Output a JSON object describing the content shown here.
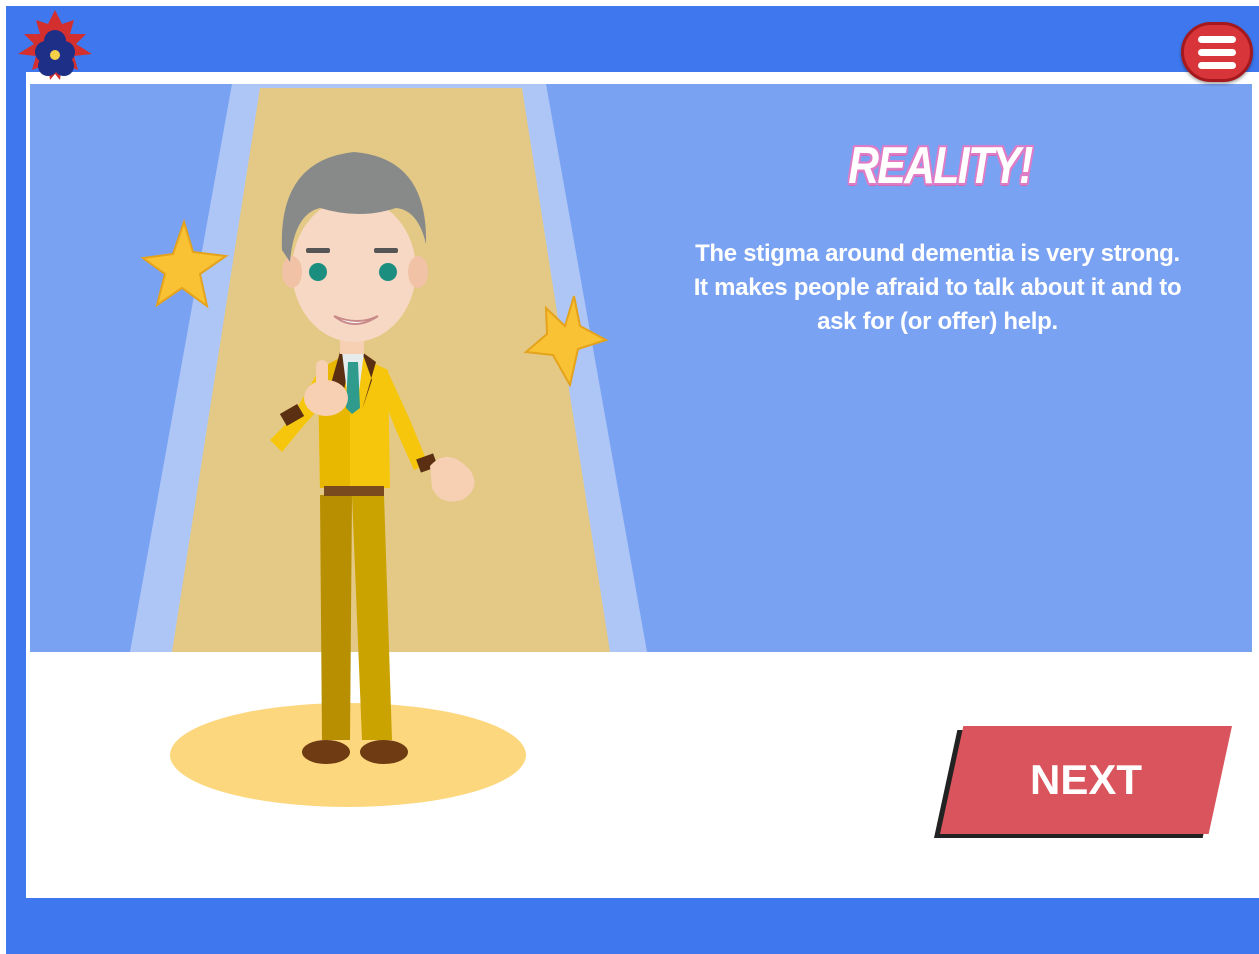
{
  "header": {
    "logo_icon": "maple-leaf-flower-logo",
    "menu_icon": "hamburger-menu-icon"
  },
  "content": {
    "heading": "REALITY!",
    "body": "The stigma around dementia is very strong. It makes people afraid to talk about it and to ask for (or offer) help."
  },
  "actions": {
    "next_label": "NEXT"
  },
  "colors": {
    "frame_blue": "#3f78ee",
    "scene_blue": "#7aa2f2",
    "next_red": "#d9545c",
    "menu_red": "#d8353b",
    "spotlight": "#e3c985"
  }
}
